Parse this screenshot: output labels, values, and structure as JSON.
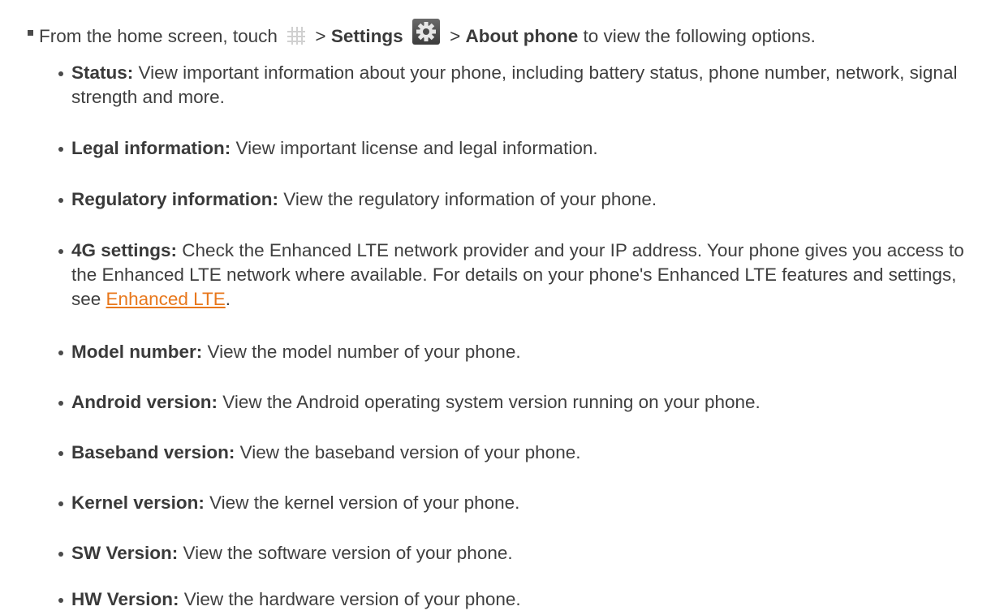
{
  "step": {
    "prefix": "From the home screen, touch",
    "sep1": ">",
    "settings": "Settings",
    "sep2": ">",
    "about": "About phone",
    "suffix": "to view the following options."
  },
  "icons": {
    "apps": "apps-grid-icon",
    "settings": "gear-icon",
    "icon_bg": "#505050"
  },
  "items": [
    {
      "term": "Status:",
      "text": "View important information about your phone, including battery status, phone number, network, signal strength and more."
    },
    {
      "term": "Legal information:",
      "text": "View important license and legal information."
    },
    {
      "term": "Regulatory information:",
      "text": "View the regulatory information of your phone."
    },
    {
      "term": "4G settings:",
      "text": "Check the Enhanced LTE network provider and your IP address. Your phone gives you access to the Enhanced LTE network where available. For details on your phone's Enhanced LTE features and settings, see",
      "link": "Enhanced LTE",
      "after": "."
    },
    {
      "term": "Model number:",
      "text": "View the model number of your phone."
    },
    {
      "term": "Android version:",
      "text": "View the Android operating system version running on your phone."
    },
    {
      "term": "Baseband version:",
      "text": "View the baseband version of your phone."
    },
    {
      "term": "Kernel version:",
      "text": "View the kernel version of your phone."
    },
    {
      "term": "SW Version:",
      "text": "View the software version of your phone."
    },
    {
      "term": "HW Version:",
      "text": "View the hardware version of your phone."
    }
  ],
  "colors": {
    "text": "#3f3f3f",
    "link": "#e8771b"
  }
}
